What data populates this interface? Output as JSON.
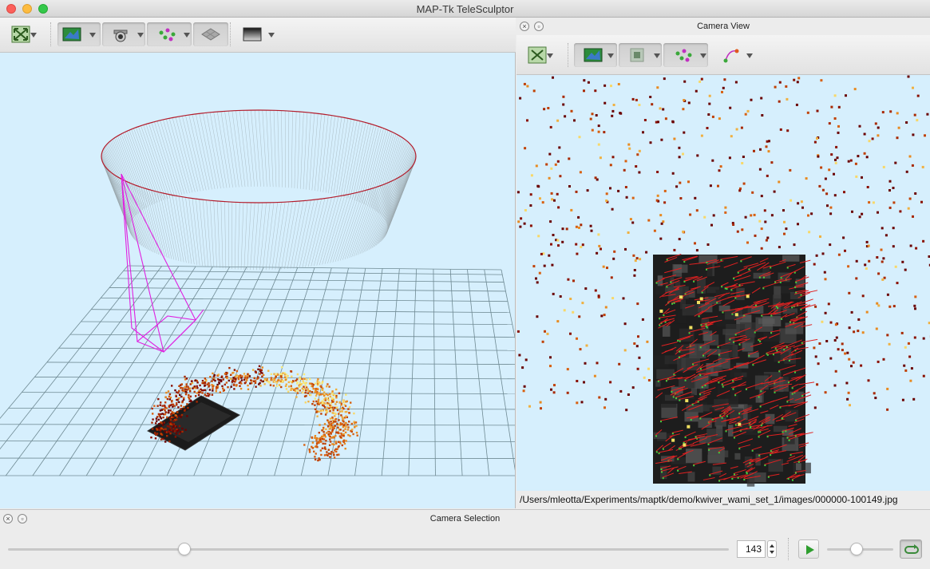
{
  "window": {
    "title": "MAP-Tk TeleSculptor"
  },
  "world_toolbar": {
    "buttons": [
      {
        "name": "reset-view-button",
        "icon": "reset-view-icon"
      },
      {
        "name": "image-display-button",
        "icon": "image-icon"
      },
      {
        "name": "camera-display-button",
        "icon": "camera-icon"
      },
      {
        "name": "landmark-display-button",
        "icon": "landmarks-icon"
      },
      {
        "name": "ground-plane-button",
        "icon": "ground-plane-icon"
      },
      {
        "name": "depth-map-button",
        "icon": "depth-map-icon"
      }
    ]
  },
  "camera_view": {
    "title": "Camera View",
    "image_path": "/Users/mleotta/Experiments/maptk/demo/kwiver_wami_set_1/images/000000-100149.jpg",
    "toolbar": [
      "reset-view-icon",
      "image-icon",
      "mask-icon",
      "landmarks-icon",
      "residuals-icon"
    ]
  },
  "camera_selection": {
    "title": "Camera Selection",
    "frame": "143",
    "slider_value": 0.245,
    "speed_value": 0.45,
    "loop_enabled": true
  },
  "colors": {
    "viewport_bg": "#d6effd",
    "camera_path": "#b31b2a",
    "frustum": "#e020e0",
    "landmark_low": "#6a0000",
    "landmark_high": "#f8e878"
  }
}
